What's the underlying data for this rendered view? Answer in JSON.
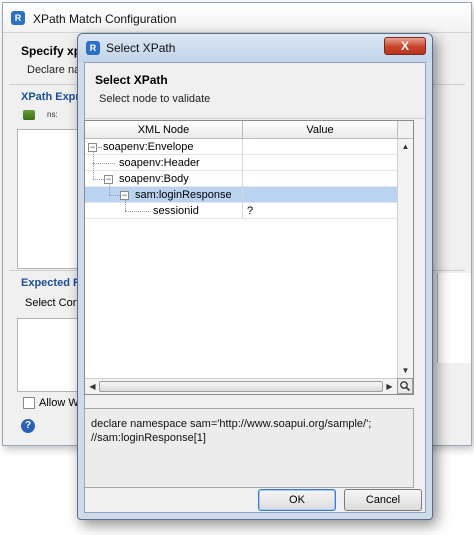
{
  "background_window": {
    "title": "XPath Match Configuration",
    "logo": "R",
    "heading": "Specify xpa",
    "description": "Declare nar",
    "section_xpath": "XPath Expre",
    "ns_label": "ns:",
    "section_expected": "Expected Re",
    "select_content": "Select Conte",
    "allow_label": "Allow Wi",
    "help": "?"
  },
  "dialog": {
    "title": "Select XPath",
    "logo": "R",
    "close": "X",
    "heading": "Select XPath",
    "subheading": "Select node to validate",
    "table": {
      "columns": [
        "XML Node",
        "Value"
      ],
      "rows": [
        {
          "label": "soapenv:Envelope",
          "value": "",
          "toggle": "−"
        },
        {
          "label": "soapenv:Header",
          "value": "",
          "toggle": ""
        },
        {
          "label": "soapenv:Body",
          "value": "",
          "toggle": "−"
        },
        {
          "label": "sam:loginResponse",
          "value": "",
          "toggle": "−"
        },
        {
          "label": "sessionid",
          "value": "?",
          "toggle": ""
        }
      ],
      "scroll_up": "▲",
      "scroll_down": "▼",
      "scroll_left": "◀",
      "scroll_right": "▶",
      "corner_icon": "magnifier-icon"
    },
    "expression": {
      "line1": "declare namespace sam='http://www.soapui.org/sample/';",
      "line2": "//sam:loginResponse[1]"
    },
    "ok_label": "OK",
    "cancel_label": "Cancel"
  },
  "colors": {
    "selection": "#bad3f0",
    "section_heading": "#1b4f9c",
    "close_button": "#c7432a"
  }
}
